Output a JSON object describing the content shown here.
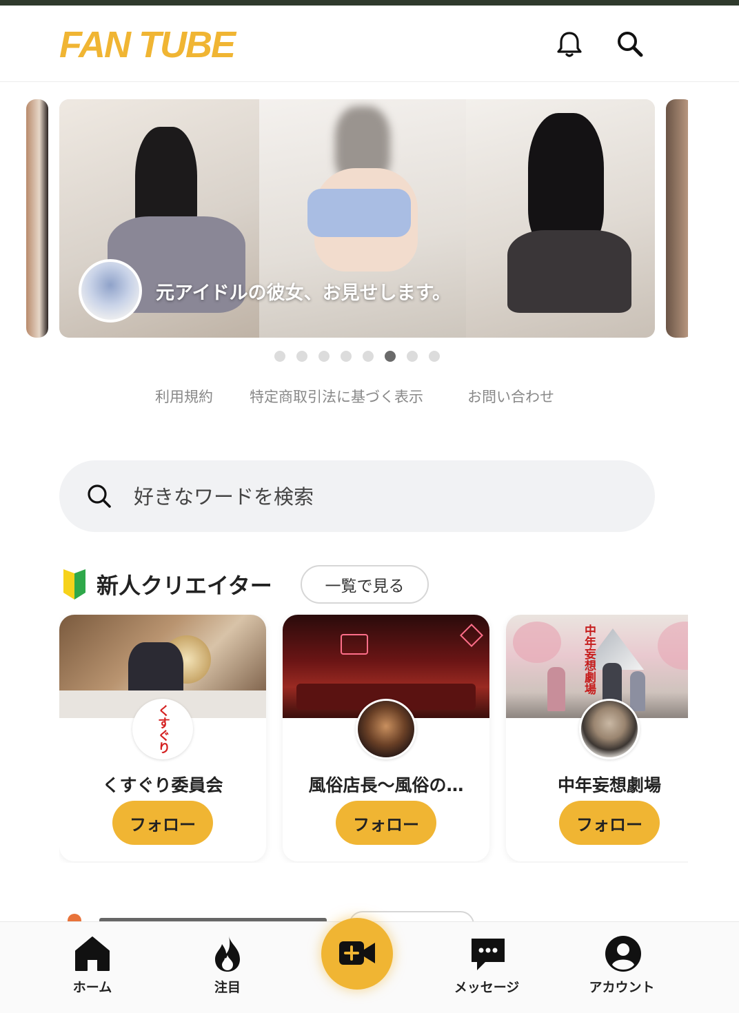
{
  "app": {
    "logo": "FAN TUBE",
    "brand_color": "#f0b533"
  },
  "header": {
    "icons": [
      "bell-icon",
      "search-icon"
    ]
  },
  "carousel": {
    "caption": "元アイドルの彼女、お見せします。",
    "dot_count": 8,
    "active_dot": 6
  },
  "footer_links": [
    "利用規約",
    "特定商取引法に基づく表示",
    "お問い合わせ"
  ],
  "search": {
    "placeholder": "好きなワードを検索"
  },
  "new_creators": {
    "title": "新人クリエイター",
    "see_all": "一覧で見る",
    "cards": [
      {
        "name": "くすぐり委員会",
        "follow": "フォロー",
        "avatar_text": "くすぐり"
      },
      {
        "name": "風俗店長〜風俗の…",
        "follow": "フォロー"
      },
      {
        "name": "中年妄想劇場",
        "follow": "フォロー",
        "banner_text": "中年妄想劇場"
      }
    ]
  },
  "bottom_nav": {
    "items": [
      {
        "label": "ホーム",
        "icon": "home-icon"
      },
      {
        "label": "注目",
        "icon": "flame-icon"
      },
      {
        "label": "メッセージ",
        "icon": "message-icon"
      },
      {
        "label": "アカウント",
        "icon": "account-icon"
      }
    ],
    "center_button": "video-add-icon"
  }
}
